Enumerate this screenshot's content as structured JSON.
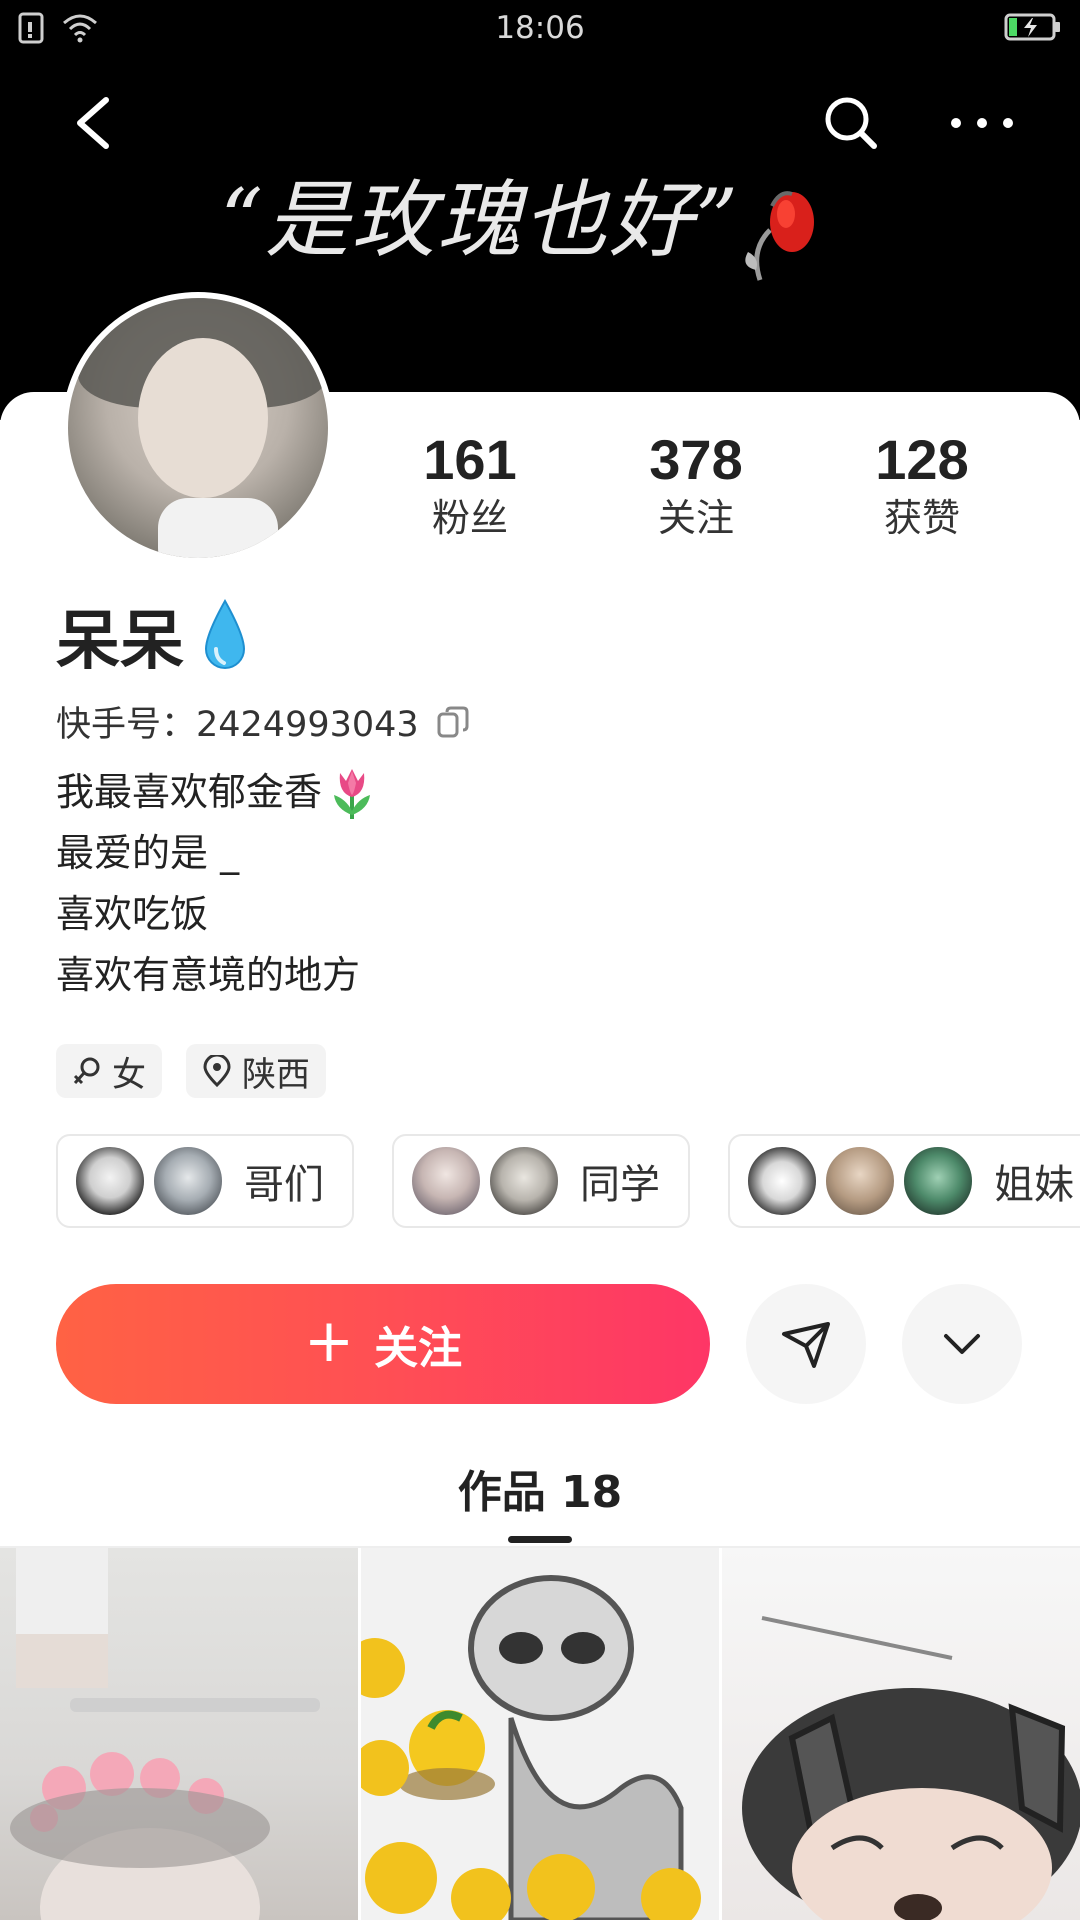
{
  "status_bar": {
    "time": "18:06"
  },
  "banner": {
    "text": "“是玫瑰也好”"
  },
  "stats": [
    {
      "value": "161",
      "label": "粉丝"
    },
    {
      "value": "378",
      "label": "关注"
    },
    {
      "value": "128",
      "label": "获赞"
    }
  ],
  "profile": {
    "name": "呆呆",
    "kuaishou_id": "快手号：2424993043",
    "bio": [
      "我最喜欢郁金香",
      "最爱的是 _",
      "喜欢吃饭",
      "喜欢有意境的地方"
    ],
    "tags": {
      "gender": "女",
      "location": "陕西"
    }
  },
  "groups": [
    "哥们",
    "同学",
    "姐妹"
  ],
  "actions": {
    "follow": "关注"
  },
  "tabs": {
    "works": "作品 18"
  },
  "colors": {
    "follow_start": "#ff6244",
    "follow_end": "#fe3666",
    "banner_bg": "#000000"
  },
  "icons": [
    "back-icon",
    "search-icon",
    "more-icon",
    "water-drop-icon",
    "copy-icon",
    "tulip-icon",
    "female-icon",
    "location-pin-icon",
    "plus-icon",
    "send-icon",
    "chevron-down-icon"
  ]
}
